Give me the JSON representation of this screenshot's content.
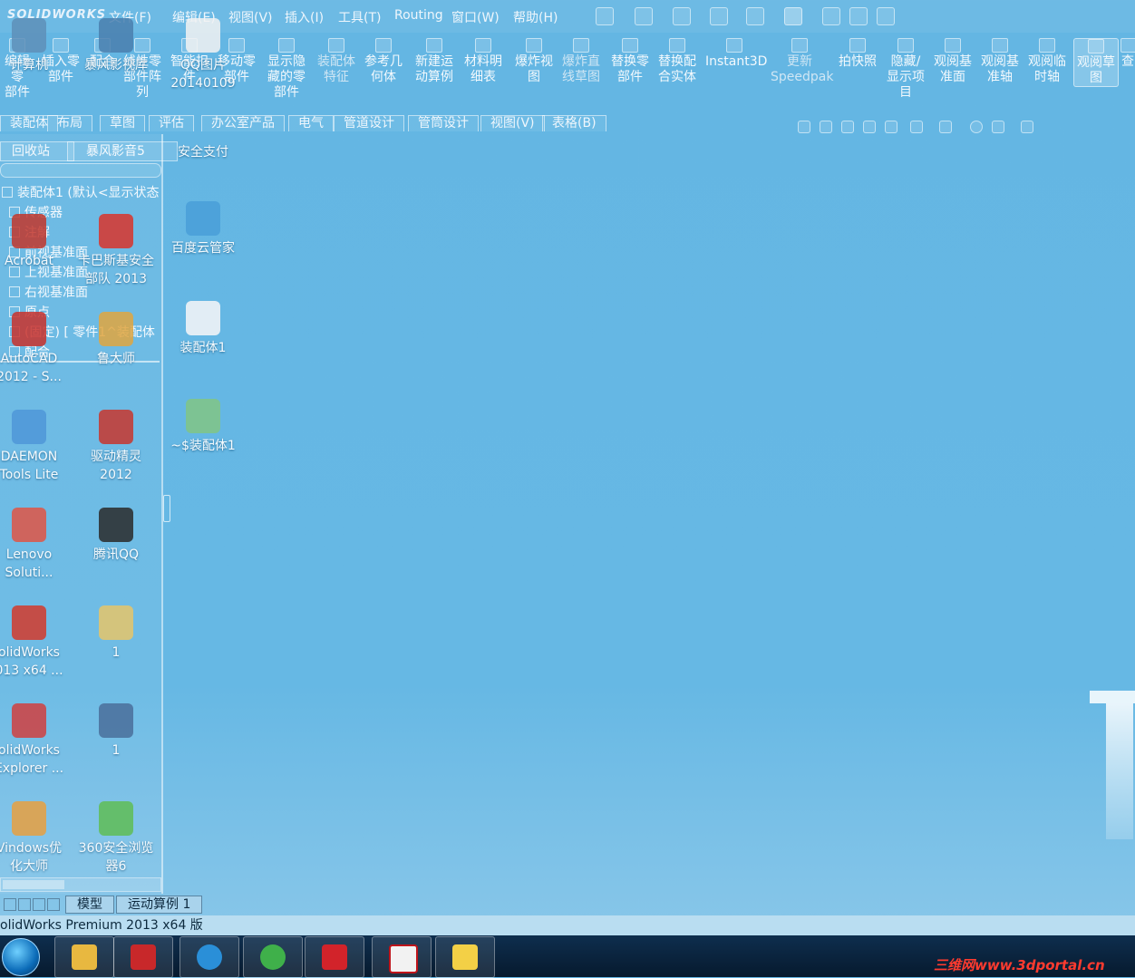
{
  "app": {
    "brand": "SOLIDWORKS",
    "status_text": "olidWorks Premium 2013 x64 版"
  },
  "menu": [
    "文件(F)",
    "编辑(E)",
    "视图(V)",
    "插入(I)",
    "工具(T)",
    "Routing",
    "窗口(W)",
    "帮助(H)"
  ],
  "ribbon": [
    {
      "label": "编辑零\n部件",
      "icon": "edit-part-icon"
    },
    {
      "label": "插入零\n部件",
      "icon": "insert-part-icon"
    },
    {
      "label": "配合",
      "icon": "mate-icon"
    },
    {
      "label": "线性零\n部件阵\n列",
      "icon": "pattern-icon"
    },
    {
      "label": "智能扣\n件",
      "icon": "fastener-icon"
    },
    {
      "label": "移动零\n部件",
      "icon": "move-part-icon"
    },
    {
      "label": "显示隐\n藏的零\n部件",
      "icon": "show-hidden-icon"
    },
    {
      "label": "装配体\n特征",
      "icon": "assembly-feature-icon"
    },
    {
      "label": "参考几\n何体",
      "icon": "reference-geometry-icon"
    },
    {
      "label": "新建运\n动算例",
      "icon": "motion-study-icon"
    },
    {
      "label": "材料明\n细表",
      "icon": "bom-icon"
    },
    {
      "label": "爆炸视\n图",
      "icon": "explode-icon"
    },
    {
      "label": "爆炸直\n线草图",
      "icon": "explode-line-icon"
    },
    {
      "label": "替换零\n部件",
      "icon": "replace-part-icon"
    },
    {
      "label": "替换配\n合实体",
      "icon": "replace-mate-icon"
    },
    {
      "label": "Instant3D",
      "icon": "instant3d-icon"
    },
    {
      "label": "更新\nSpeedpak",
      "icon": "speedpak-icon"
    },
    {
      "label": "拍快照",
      "icon": "snapshot-icon"
    },
    {
      "label": "隐藏/\n显示项\n目",
      "icon": "hide-show-icon"
    },
    {
      "label": "观阅基\n准面",
      "icon": "view-planes-icon"
    },
    {
      "label": "观阅基\n准轴",
      "icon": "view-axes-icon"
    },
    {
      "label": "观阅临\n时轴",
      "icon": "view-temp-axes-icon"
    },
    {
      "label": "观阅草\n图",
      "icon": "view-sketch-icon"
    },
    {
      "label": "查",
      "icon": "check-icon"
    }
  ],
  "tabs": [
    "装配体",
    "布局",
    "草图",
    "评估",
    "办公室产品",
    "电气",
    "管道设计",
    "管筒设计",
    "视图(V)",
    "表格(B)"
  ],
  "panel_tabs": [
    "回收站",
    "暴风影音5"
  ],
  "tree": [
    "装配体1 (默认<显示状态",
    "传感器",
    "注解",
    "前视基准面",
    "上视基准面",
    "右视基准面",
    "原点",
    "(固定) [ 零件1^装配体",
    "配合"
  ],
  "desktop_icons_left": [
    {
      "name": "计算机"
    },
    {
      "name": "暴风影视库"
    },
    {
      "name": "QQ图片\n20140109"
    },
    {
      "name": "卡巴斯基安全\n部队 2013"
    },
    {
      "name": "Acrobat"
    },
    {
      "name": "AutoCAD\n2012 - S..."
    },
    {
      "name": "鲁大师"
    },
    {
      "name": "DAEMON\nTools Lite"
    },
    {
      "name": "驱动精灵\n2012"
    },
    {
      "name": "Lenovo\nSoluti..."
    },
    {
      "name": "腾讯QQ"
    },
    {
      "name": "olidWorks\n013 x64 ..."
    },
    {
      "name": "1"
    },
    {
      "name": "olidWorks\nExplorer ..."
    },
    {
      "name": "1"
    },
    {
      "name": "Vindows优\n化大师"
    },
    {
      "name": "360安全浏览\n器6"
    }
  ],
  "desktop_icons_right": [
    {
      "name": "安全支付"
    },
    {
      "name": "百度云管家"
    },
    {
      "name": "装配体1"
    },
    {
      "name": "~$装配体1"
    }
  ],
  "bottom_tabs": [
    "模型",
    "运动算例 1"
  ],
  "watermark": "三维网www.3dportal.cn",
  "colors": {
    "background": "#66b8e4",
    "accent": "#b9ddf1",
    "taskbar": "#0b2540"
  }
}
